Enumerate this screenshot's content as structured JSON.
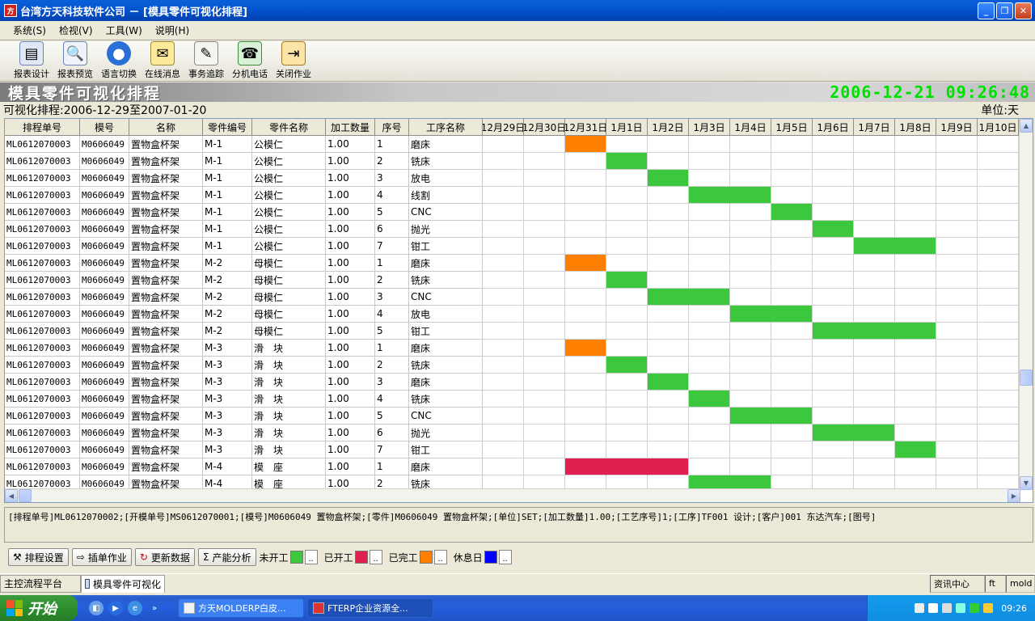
{
  "window": {
    "title": "台湾方天科技软件公司 － [模具零件可视化排程]"
  },
  "menu": [
    "系统(S)",
    "检视(V)",
    "工具(W)",
    "说明(H)"
  ],
  "toolbar": [
    {
      "label": "报表设计",
      "icon": "report-design-icon"
    },
    {
      "label": "报表预览",
      "icon": "report-preview-icon"
    },
    {
      "label": "语言切换",
      "icon": "language-switch-icon"
    },
    {
      "label": "在线消息",
      "icon": "online-message-icon"
    },
    {
      "label": "事务追踪",
      "icon": "task-tracking-icon"
    },
    {
      "label": "分机电话",
      "icon": "phone-icon"
    },
    {
      "label": "关闭作业",
      "icon": "close-job-icon"
    }
  ],
  "banner": {
    "title": "模具零件可视化排程",
    "clock": "2006-12-21 09:26:48"
  },
  "subheader": {
    "range": "可视化排程:2006-12-29至2007-01-20",
    "unit": "单位:天"
  },
  "columns": [
    "排程单号",
    "模号",
    "名称",
    "零件编号",
    "零件名称",
    "加工数量",
    "序号",
    "工序名称"
  ],
  "dates": [
    "12月29日",
    "12月30日",
    "12月31日",
    "1月1日",
    "1月2日",
    "1月3日",
    "1月4日",
    "1月5日",
    "1月6日",
    "1月7日",
    "1月8日",
    "1月9日",
    "1月10日"
  ],
  "rows": [
    [
      "ML0612070003",
      "M0606049",
      "置物盒杯架",
      "M-1",
      "公模仁",
      "1.00",
      "1",
      "磨床"
    ],
    [
      "ML0612070003",
      "M0606049",
      "置物盒杯架",
      "M-1",
      "公模仁",
      "1.00",
      "2",
      "铣床"
    ],
    [
      "ML0612070003",
      "M0606049",
      "置物盒杯架",
      "M-1",
      "公模仁",
      "1.00",
      "3",
      "放电"
    ],
    [
      "ML0612070003",
      "M0606049",
      "置物盒杯架",
      "M-1",
      "公模仁",
      "1.00",
      "4",
      "线割"
    ],
    [
      "ML0612070003",
      "M0606049",
      "置物盒杯架",
      "M-1",
      "公模仁",
      "1.00",
      "5",
      "CNC"
    ],
    [
      "ML0612070003",
      "M0606049",
      "置物盒杯架",
      "M-1",
      "公模仁",
      "1.00",
      "6",
      "抛光"
    ],
    [
      "ML0612070003",
      "M0606049",
      "置物盒杯架",
      "M-1",
      "公模仁",
      "1.00",
      "7",
      "钳工"
    ],
    [
      "ML0612070003",
      "M0606049",
      "置物盒杯架",
      "M-2",
      "母模仁",
      "1.00",
      "1",
      "磨床"
    ],
    [
      "ML0612070003",
      "M0606049",
      "置物盒杯架",
      "M-2",
      "母模仁",
      "1.00",
      "2",
      "铣床"
    ],
    [
      "ML0612070003",
      "M0606049",
      "置物盒杯架",
      "M-2",
      "母模仁",
      "1.00",
      "3",
      "CNC"
    ],
    [
      "ML0612070003",
      "M0606049",
      "置物盒杯架",
      "M-2",
      "母模仁",
      "1.00",
      "4",
      "放电"
    ],
    [
      "ML0612070003",
      "M0606049",
      "置物盒杯架",
      "M-2",
      "母模仁",
      "1.00",
      "5",
      "钳工"
    ],
    [
      "ML0612070003",
      "M0606049",
      "置物盒杯架",
      "M-3",
      "滑　块",
      "1.00",
      "1",
      "磨床"
    ],
    [
      "ML0612070003",
      "M0606049",
      "置物盒杯架",
      "M-3",
      "滑　块",
      "1.00",
      "2",
      "铣床"
    ],
    [
      "ML0612070003",
      "M0606049",
      "置物盒杯架",
      "M-3",
      "滑　块",
      "1.00",
      "3",
      "磨床"
    ],
    [
      "ML0612070003",
      "M0606049",
      "置物盒杯架",
      "M-3",
      "滑　块",
      "1.00",
      "4",
      "铣床"
    ],
    [
      "ML0612070003",
      "M0606049",
      "置物盒杯架",
      "M-3",
      "滑　块",
      "1.00",
      "5",
      "CNC"
    ],
    [
      "ML0612070003",
      "M0606049",
      "置物盒杯架",
      "M-3",
      "滑　块",
      "1.00",
      "6",
      "抛光"
    ],
    [
      "ML0612070003",
      "M0606049",
      "置物盒杯架",
      "M-3",
      "滑　块",
      "1.00",
      "7",
      "钳工"
    ],
    [
      "ML0612070003",
      "M0606049",
      "置物盒杯架",
      "M-4",
      "模　座",
      "1.00",
      "1",
      "磨床"
    ],
    [
      "ML0612070003",
      "M0606049",
      "置物盒杯架",
      "M-4",
      "模　座",
      "1.00",
      "2",
      "铣床"
    ]
  ],
  "schedule": [
    {
      "row": 0,
      "start": 2,
      "days": 1,
      "status": "done"
    },
    {
      "row": 1,
      "start": 3,
      "days": 1,
      "status": "not_started"
    },
    {
      "row": 2,
      "start": 4,
      "days": 1,
      "status": "not_started"
    },
    {
      "row": 3,
      "start": 5,
      "days": 2,
      "status": "not_started"
    },
    {
      "row": 4,
      "start": 7,
      "days": 1,
      "status": "not_started"
    },
    {
      "row": 5,
      "start": 8,
      "days": 1,
      "status": "not_started"
    },
    {
      "row": 6,
      "start": 9,
      "days": 2,
      "status": "not_started"
    },
    {
      "row": 7,
      "start": 2,
      "days": 1,
      "status": "done"
    },
    {
      "row": 8,
      "start": 3,
      "days": 1,
      "status": "not_started"
    },
    {
      "row": 9,
      "start": 4,
      "days": 2,
      "status": "not_started"
    },
    {
      "row": 10,
      "start": 6,
      "days": 2,
      "status": "not_started"
    },
    {
      "row": 11,
      "start": 8,
      "days": 3,
      "status": "not_started"
    },
    {
      "row": 12,
      "start": 2,
      "days": 1,
      "status": "done"
    },
    {
      "row": 13,
      "start": 3,
      "days": 1,
      "status": "not_started"
    },
    {
      "row": 14,
      "start": 4,
      "days": 1,
      "status": "not_started"
    },
    {
      "row": 15,
      "start": 5,
      "days": 1,
      "status": "not_started"
    },
    {
      "row": 16,
      "start": 6,
      "days": 2,
      "status": "not_started"
    },
    {
      "row": 17,
      "start": 8,
      "days": 2,
      "status": "not_started"
    },
    {
      "row": 18,
      "start": 10,
      "days": 1,
      "status": "not_started"
    },
    {
      "row": 19,
      "start": 2,
      "days": 3,
      "status": "started"
    },
    {
      "row": 20,
      "start": 5,
      "days": 2,
      "status": "not_started"
    }
  ],
  "colors": {
    "not_started": "#3cc83c",
    "started": "#e01e50",
    "done": "#ff8000",
    "holiday": "#0000ff"
  },
  "info": "[排程单号]ML0612070002;[开模单号]MS0612070001;[模号]M0606049 置物盒杯架;[零件]M0606049 置物盒杯架;[单位]SET;[加工数量]1.00;[工艺序号]1;[工序]TF001 设计;[客户]001 东达汽车;[图号]",
  "actions": {
    "schedule_settings": "排程设置",
    "insert_job": "插单作业",
    "refresh": "更新数据",
    "capacity": "产能分析"
  },
  "legend": {
    "not_started": "未开工",
    "started": "已开工",
    "done": "已完工",
    "holiday": "休息日",
    "more": ".."
  },
  "status": {
    "tab1": "主控流程平台",
    "tab2": "模具零件可视化",
    "panel1": "资讯中心",
    "panel2": "ft",
    "panel3": "mold"
  },
  "taskbar": {
    "start": "开始",
    "item1": "方天MOLDERP白皮...",
    "item2": "FTERP企业资源全...",
    "time": "09:26",
    "quicklaunch": "»"
  }
}
